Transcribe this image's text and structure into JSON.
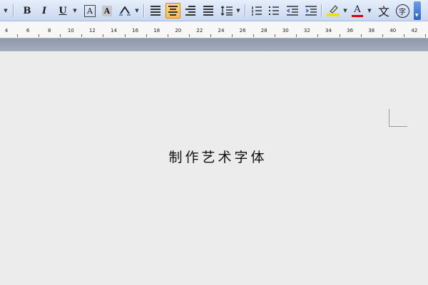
{
  "toolbar": {
    "bold_label": "B",
    "italic_label": "I",
    "underline_label": "U",
    "border_char_label": "A",
    "shade_char_label": "A",
    "font_color_label": "A",
    "phonetic_label": "文",
    "enclose_label": "字",
    "colors": {
      "highlight": "#f3e000",
      "font_color": "#e00000",
      "active": "#ffbb4f"
    },
    "icons": [
      "menu-dropdown-icon",
      "bold-icon",
      "italic-icon",
      "underline-icon",
      "character-border-icon",
      "character-shading-icon",
      "char-scale-icon",
      "align-left-icon",
      "align-center-icon",
      "align-right-icon",
      "justify-icon",
      "line-spacing-icon",
      "numbering-icon",
      "bullets-icon",
      "decrease-indent-icon",
      "increase-indent-icon",
      "highlight-icon",
      "font-color-icon",
      "phonetic-guide-icon",
      "enclose-characters-icon",
      "toolbar-options-icon"
    ]
  },
  "ruler": {
    "labels": [
      "4",
      "6",
      "8",
      "10",
      "12",
      "14",
      "16",
      "18",
      "20",
      "22",
      "24",
      "26",
      "28",
      "30",
      "32",
      "34",
      "36",
      "38",
      "40",
      "42"
    ]
  },
  "document": {
    "text": "制作艺术字体"
  }
}
